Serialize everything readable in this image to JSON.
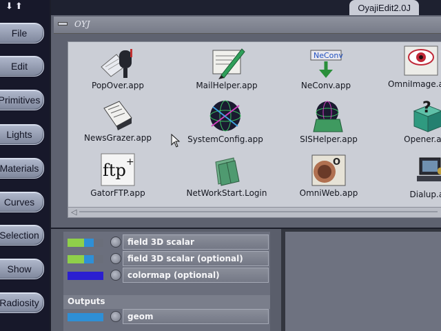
{
  "sidebar": {
    "arrows": "⬇⬆",
    "items": [
      {
        "label": "File"
      },
      {
        "label": "Edit"
      },
      {
        "label": "Primitives"
      },
      {
        "label": "Lights"
      },
      {
        "label": "Materials"
      },
      {
        "label": "Curves"
      },
      {
        "label": "Selection"
      },
      {
        "label": "Show"
      },
      {
        "label": "Radiosity"
      }
    ]
  },
  "window": {
    "title": "OyajiEdit2.0J",
    "path": "OYJ"
  },
  "apps": [
    {
      "label": "PopOver.app",
      "icon": "mailbox-icon"
    },
    {
      "label": "MailHelper.app",
      "icon": "mail-pen-icon"
    },
    {
      "label": "NeConv.app",
      "icon": "neconv-icon"
    },
    {
      "label": "OmniImage.app",
      "icon": "eye-image-icon"
    },
    {
      "label": "NewsGrazer.app",
      "icon": "newspaper-icon"
    },
    {
      "label": "SystemConfig.app",
      "icon": "globe-grid-icon"
    },
    {
      "label": "SISHelper.app",
      "icon": "globe-folder-icon"
    },
    {
      "label": "Opener.app",
      "icon": "question-box-icon"
    },
    {
      "label": "GatorFTP.app",
      "icon": "ftp-icon"
    },
    {
      "label": "NetWorkStart.Login",
      "icon": "network-folder-icon"
    },
    {
      "label": "OmniWeb.app",
      "icon": "omniweb-icon"
    },
    {
      "label": "Dialup.app",
      "icon": "dialup-computer-icon"
    }
  ],
  "ports": {
    "inputs": [
      {
        "label": "field 3D scalar",
        "swatch": "field"
      },
      {
        "label": "field 3D scalar  (optional)",
        "swatch": "field"
      },
      {
        "label": "colormap  (optional)",
        "swatch": "colormap"
      }
    ],
    "outputs_header": "Outputs",
    "outputs": [
      {
        "label": "geom",
        "swatch": "geom"
      }
    ]
  },
  "colors": {
    "field_green": "#8fd04a",
    "field_blue": "#2e8fd6",
    "colormap_blue": "#2b1fd0",
    "geom_blue": "#2e8fd6"
  }
}
